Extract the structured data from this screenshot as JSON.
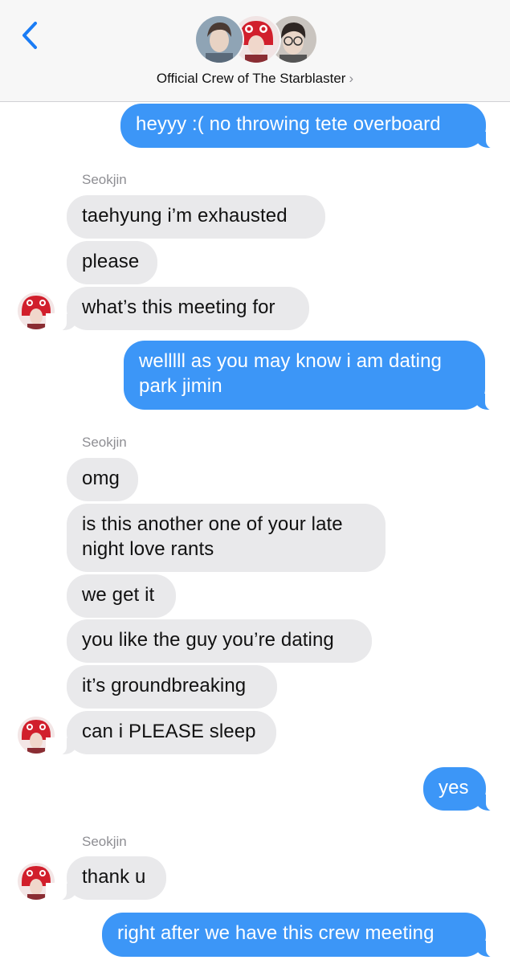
{
  "header": {
    "title": "Official Crew of The Starblaster",
    "chevron": "›",
    "back_icon": "chevron-left-icon",
    "avatars": [
      "member-avatar-1",
      "member-avatar-2",
      "member-avatar-3"
    ]
  },
  "colors": {
    "outgoing_bubble": "#3c96f7",
    "incoming_bubble": "#e9e9eb",
    "accent": "#1a7cf5"
  },
  "messages": [
    {
      "dir": "out",
      "text": "heyyy :( no throwing tete overboard"
    },
    {
      "sender": "Seokjin"
    },
    {
      "dir": "in",
      "text": "taehyung i’m exhausted"
    },
    {
      "dir": "in",
      "text": "please"
    },
    {
      "dir": "in",
      "text": "what’s this meeting for"
    },
    {
      "dir": "out",
      "lines": [
        "welllll as you may know i am dating",
        "park jimin"
      ]
    },
    {
      "sender": "Seokjin"
    },
    {
      "dir": "in",
      "text": "omg"
    },
    {
      "dir": "in",
      "lines": [
        "is this another one of your late",
        "night love rants"
      ]
    },
    {
      "dir": "in",
      "text": "we get it"
    },
    {
      "dir": "in",
      "text": "you like the guy you’re dating"
    },
    {
      "dir": "in",
      "text": "it’s groundbreaking"
    },
    {
      "dir": "in",
      "text": "can i PLEASE sleep"
    },
    {
      "dir": "out",
      "text": "yes"
    },
    {
      "sender": "Seokjin"
    },
    {
      "dir": "in",
      "text": "thank u"
    },
    {
      "dir": "out",
      "text": "right after we have this crew meeting"
    }
  ]
}
